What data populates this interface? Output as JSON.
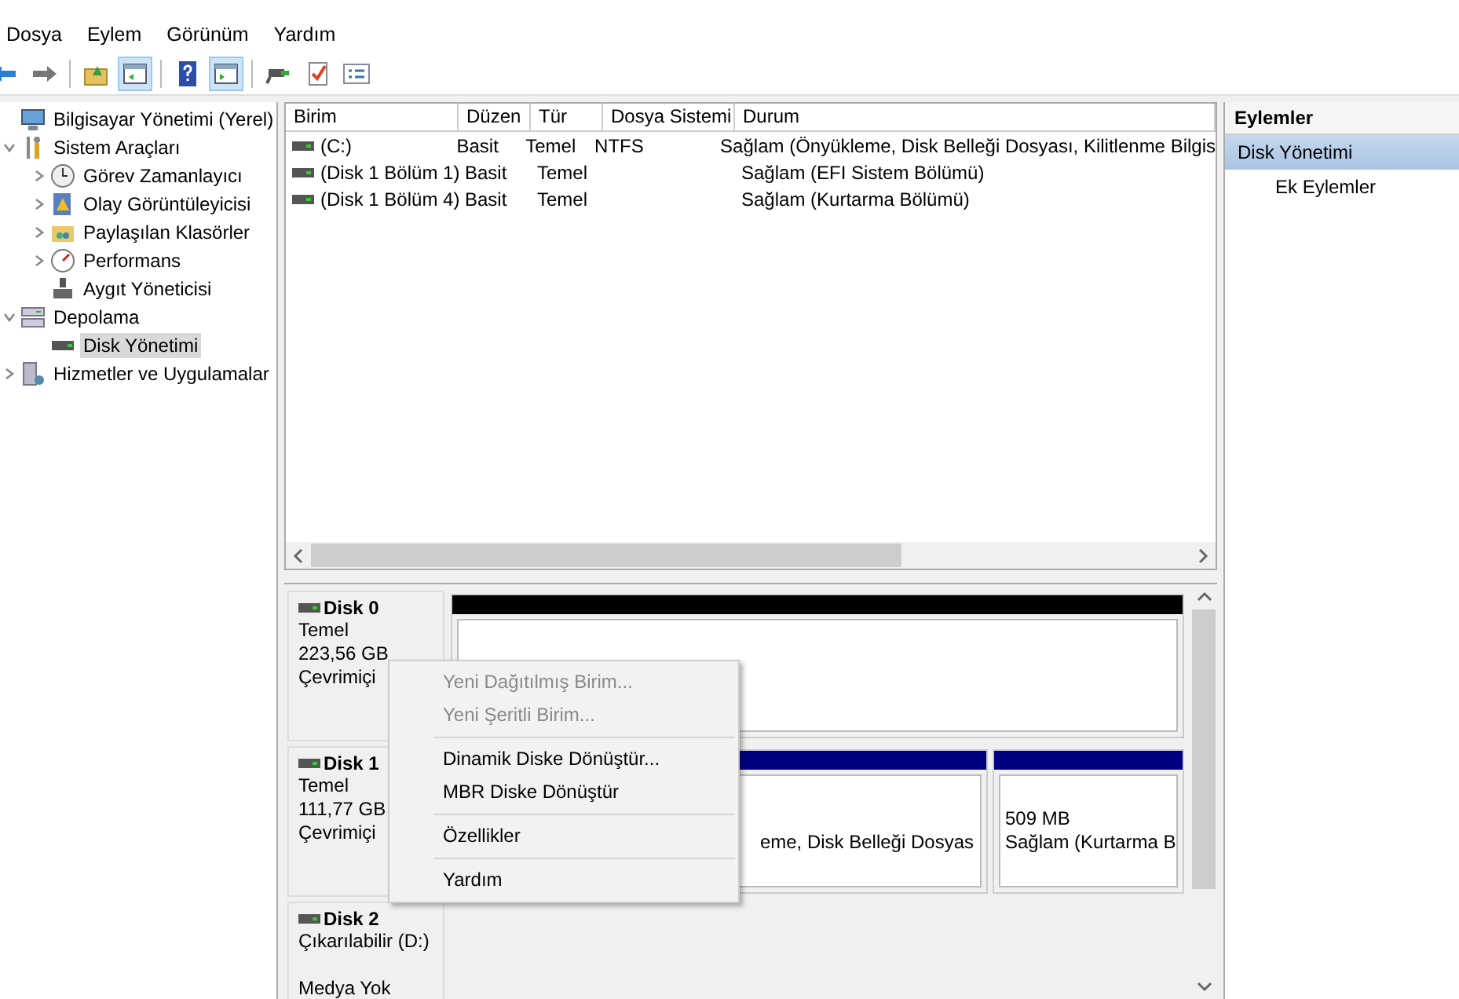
{
  "menu": [
    "Dosya",
    "Eylem",
    "Görünüm",
    "Yardım"
  ],
  "toolbar": [
    {
      "pressed": false
    },
    {
      "pressed": false
    },
    {
      "pressed": false
    },
    {
      "pressed": true
    },
    {
      "pressed": false
    },
    {
      "pressed": true
    },
    {
      "pressed": false
    },
    {
      "pressed": false
    },
    {
      "pressed": false
    }
  ],
  "tree": [
    {
      "label": "Bilgisayar Yönetimi (Yerel)",
      "selected": false,
      "children": [
        {
          "label": "Sistem Araçları",
          "expanded": true,
          "selected": false,
          "children": [
            {
              "label": "Görev Zamanlayıcı",
              "expanded": false,
              "selected": false
            },
            {
              "label": "Olay Görüntüleyicisi",
              "expanded": false,
              "selected": false
            },
            {
              "label": "Paylaşılan Klasörler",
              "expanded": false,
              "selected": false
            },
            {
              "label": "Performans",
              "expanded": false,
              "selected": false
            },
            {
              "label": "Aygıt Yöneticisi",
              "selected": false
            }
          ]
        },
        {
          "label": "Depolama",
          "expanded": true,
          "selected": false,
          "children": [
            {
              "label": "Disk Yönetimi",
              "selected": true
            }
          ]
        },
        {
          "label": "Hizmetler ve Uygulamalar",
          "expanded": false,
          "selected": false
        }
      ]
    }
  ],
  "volumes": {
    "columns": [
      "Birim",
      "Düzen",
      "Tür",
      "Dosya Sistemi",
      "Durum"
    ],
    "rows": [
      [
        "(C:)",
        "Basit",
        "Temel",
        "NTFS",
        "Sağlam (Önyükleme, Disk Belleği Dosyası, Kilitlenme Bilgis"
      ],
      [
        "(Disk 1 Bölüm 1)",
        "Basit",
        "Temel",
        "",
        "Sağlam (EFI Sistem Bölümü)"
      ],
      [
        "(Disk 1 Bölüm 4)",
        "Basit",
        "Temel",
        "",
        "Sağlam (Kurtarma Bölümü)"
      ]
    ]
  },
  "disks": [
    {
      "name": "Disk 0",
      "lines": [
        "Temel",
        "223,56 GB",
        "Çevrimiçi"
      ],
      "partitions": [
        {
          "kind": "unallocated"
        }
      ]
    },
    {
      "name": "Disk 1",
      "lines": [
        "Temel",
        "111,77 GB",
        "Çevrimiçi"
      ],
      "partitions": [
        {
          "kind": "primary",
          "lines": [
            "eme, Disk Belleği Dosyas"
          ]
        },
        {
          "kind": "primary",
          "lines": [
            "509 MB",
            "Sağlam (Kurtarma B"
          ]
        }
      ]
    },
    {
      "name": "Disk 2",
      "lines": [
        "Çıkarılabilir (D:)",
        "Medya Yok"
      ]
    }
  ],
  "context_menu": [
    {
      "kind": "item",
      "label": "Yeni Dağıtılmış Birim...",
      "disabled": true
    },
    {
      "kind": "item",
      "label": "Yeni Şeritli Birim...",
      "disabled": true
    },
    {
      "kind": "separator"
    },
    {
      "kind": "item",
      "label": "Dinamik Diske Dönüştür...",
      "disabled": false
    },
    {
      "kind": "item",
      "label": "MBR Diske Dönüştür",
      "disabled": false
    },
    {
      "kind": "separator"
    },
    {
      "kind": "item",
      "label": "Özellikler",
      "disabled": false
    },
    {
      "kind": "separator"
    },
    {
      "kind": "item",
      "label": "Yardım",
      "disabled": false
    }
  ],
  "actions": {
    "title": "Eylemler",
    "items": [
      {
        "label": "Disk Yönetimi",
        "selected": true
      },
      {
        "label": "Ek Eylemler",
        "selected": false
      }
    ]
  }
}
